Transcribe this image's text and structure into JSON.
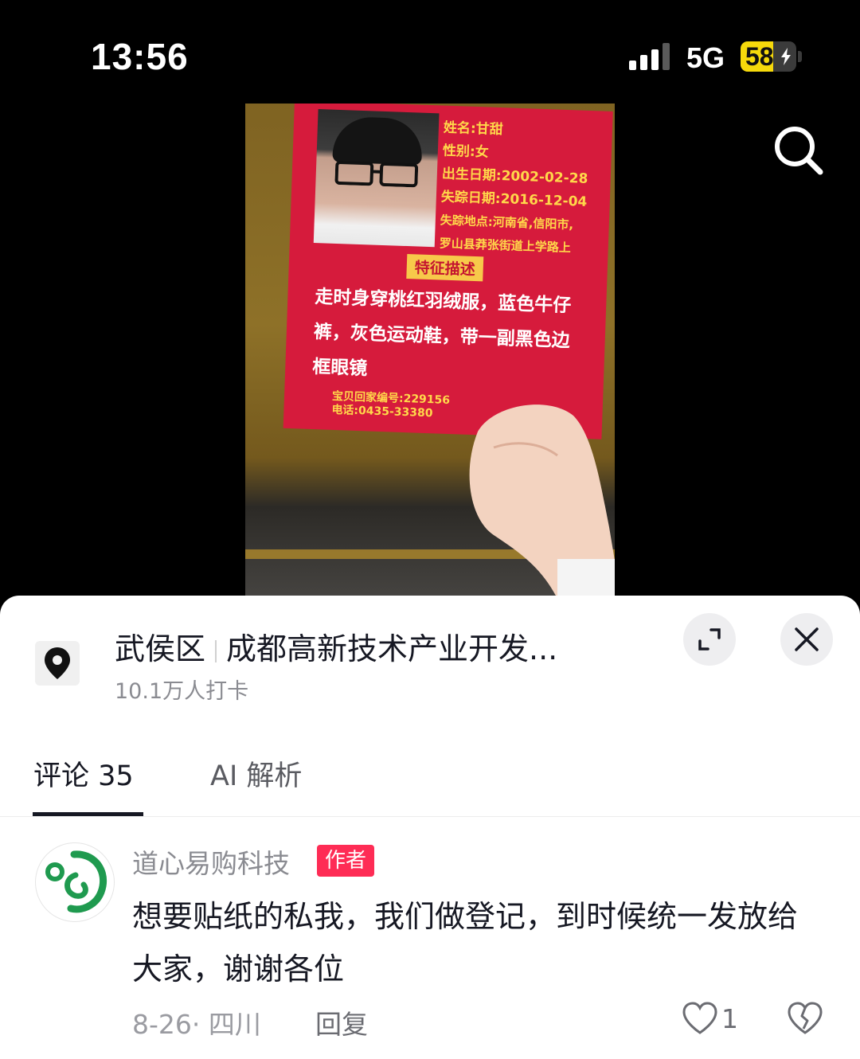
{
  "status_bar": {
    "time": "13:56",
    "network": "5G",
    "battery": "58",
    "battery_level": 0.58
  },
  "poster": {
    "info_lines": [
      "姓名:甘甜",
      "性别:女",
      "出生日期:2002-02-28",
      "失踪日期:2016-12-04",
      "失踪地点:河南省,信阳市,",
      "罗山县莽张街道上学路上"
    ],
    "feature_label": "特征描述",
    "feature_text": "走时身穿桃红羽绒服，蓝色牛仔裤，灰色运动鞋，带一副黑色边框眼镜",
    "footer_id": "宝贝回家编号:229156",
    "footer_phone": "电话:0435-33380"
  },
  "location": {
    "district": "武侯区",
    "place": "成都高新技术产业开发...",
    "checkins": "10.1万人打卡"
  },
  "tabs": {
    "comments": "评论 35",
    "ai": "AI 解析"
  },
  "comment": {
    "username": "道心易购科技",
    "badge": "作者",
    "text": "想要贴纸的私我，我们做登记，到时候统一发放给大家，谢谢各位",
    "meta": "8-26· 四川",
    "reply": "回复",
    "likes": "1"
  },
  "icons": {
    "search": "search-icon",
    "location": "location-pin-icon",
    "expand": "expand-icon",
    "close": "close-icon",
    "like": "heart-icon",
    "dislike": "broken-heart-icon"
  },
  "colors": {
    "accent": "#fe2c55",
    "poster_red": "#d61b3c",
    "battery": "#f6d90b"
  }
}
